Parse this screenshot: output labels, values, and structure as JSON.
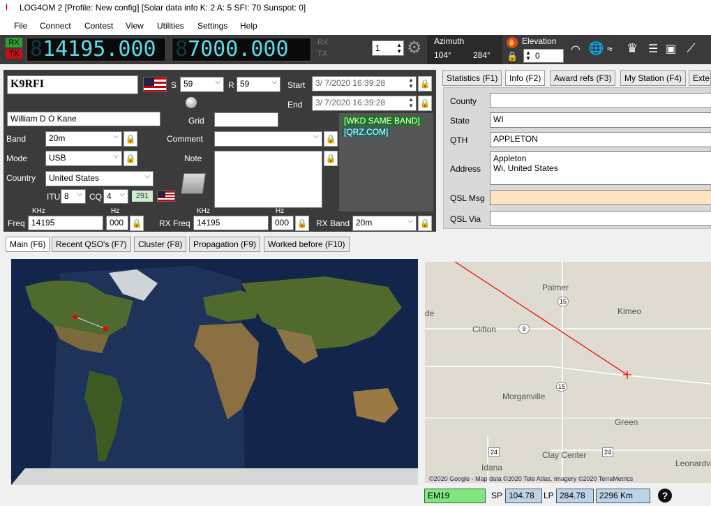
{
  "window": {
    "title": "LOG4OM 2 [Profile: New config] [Solar data info K: 2 A: 5 SFI: 70 Sunspot: 0]"
  },
  "menu": [
    "File",
    "Connect",
    "Contest",
    "View",
    "Utilities",
    "Settings",
    "Help"
  ],
  "toolbar": {
    "rx": "RX",
    "tx": "TX",
    "freq_main": "14195.000",
    "freq_main_dim": "8",
    "freq_rx": "7000.000",
    "freq_rx_dim": "8",
    "rx2": "RX",
    "tx2": "TX",
    "radio_num": "1",
    "azimuth_label": "Azimuth",
    "azimuth_sp": "104°",
    "azimuth_lp": "284°",
    "elevation_label": "Elevation",
    "elevation_value": "0"
  },
  "qso": {
    "callsign": "K9RFI",
    "s_label": "S",
    "s_value": "59",
    "r_label": "R",
    "r_value": "59",
    "start_label": "Start",
    "start_value": "3/ 7/2020 16:39:28",
    "end_label": "End",
    "end_value": "3/ 7/2020 16:39:28",
    "name": "William D O Kane",
    "grid_label": "Grid",
    "grid_value": "",
    "band_label": "Band",
    "band_value": "20m",
    "comment_label": "Comment",
    "comment_value": "",
    "mode_label": "Mode",
    "mode_value": "USB",
    "note_label": "Note",
    "country_label": "Country",
    "country_value": "United States",
    "itu_label": "ITU",
    "itu_value": "8",
    "cq_label": "CQ",
    "cq_value": "4",
    "dxcc": "291",
    "khz_label": "KHz",
    "hz_label": "Hz",
    "freq_label": "Freq",
    "freq_value": "14195",
    "freq_hz": "000",
    "rxfreq_label": "RX Freq",
    "rxfreq_value": "14195",
    "rxfreq_hz": "000",
    "rxband_label": "RX Band",
    "rxband_value": "20m",
    "wkd_tag": "[WKD SAME BAND]",
    "qrz_tag": "[QRZ.COM]"
  },
  "info_tabs": [
    "Statistics (F1)",
    "Info (F2)",
    "Award refs (F3)",
    "My Station (F4)",
    "Exte"
  ],
  "info": {
    "county_label": "County",
    "county_value": "",
    "state_label": "State",
    "state_value": "WI",
    "qth_label": "QTH",
    "qth_value": "APPLETON",
    "address_label": "Address",
    "address_line1": "Appleton",
    "address_line2": "Wi, United States",
    "qslmsg_label": "QSL Msg",
    "qslmsg_value": "",
    "qslvia_label": "QSL Via",
    "qslvia_value": ""
  },
  "main_tabs": [
    "Main (F6)",
    "Recent QSO's (F7)",
    "Cluster (F8)",
    "Propagation (F9)",
    "Worked before (F10)"
  ],
  "localmap": {
    "places": [
      "Palmer",
      "Kimeo",
      "Clifton",
      "Morganville",
      "Green",
      "Idana",
      "Clay Center",
      "Leonardvi",
      "de"
    ],
    "routes": [
      "15",
      "9",
      "15",
      "24",
      "24"
    ],
    "credit": "©2020 Google - Map data ©2020 Tele Atlas, Imagery ©2020 TerraMetrics"
  },
  "status": {
    "locator": "EM19",
    "sp_label": "SP",
    "sp_value": "104.78",
    "lp_label": "LP",
    "lp_value": "284.78",
    "distance": "2296 Km",
    "help": "?"
  }
}
